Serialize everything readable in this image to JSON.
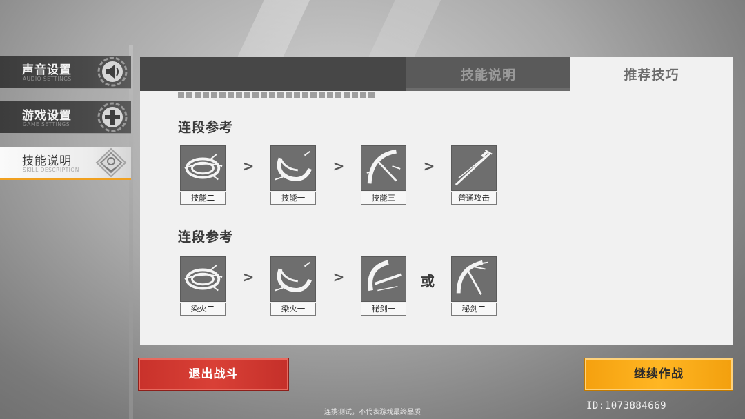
{
  "side_menu": {
    "items": [
      {
        "title": "声音设置",
        "subtitle": "AUDIO SETTINGS",
        "icon": "speaker-icon"
      },
      {
        "title": "游戏设置",
        "subtitle": "GAME SETTINGS",
        "icon": "gamepad-icon"
      },
      {
        "title": "技能说明",
        "subtitle": "SKILL DESCRIPTION",
        "icon": "skill-emblem-icon",
        "active": true
      }
    ]
  },
  "tabs": {
    "skill_description": "技能说明",
    "recommended_tips": "推荐技巧",
    "active": "recommended_tips"
  },
  "combos": [
    {
      "title": "连段参考",
      "skills": [
        {
          "label": "技能二",
          "icon": "swirl-slash-icon"
        },
        {
          "label": "技能一",
          "icon": "crescent-slash-icon"
        },
        {
          "label": "技能三",
          "icon": "crossed-blades-icon"
        },
        {
          "label": "普通攻击",
          "icon": "katana-icon"
        }
      ],
      "separators": [
        ">",
        ">",
        ">"
      ]
    },
    {
      "title": "连段参考",
      "skills": [
        {
          "label": "染火二",
          "icon": "swirl-slash-icon"
        },
        {
          "label": "染火一",
          "icon": "crescent-slash-icon"
        },
        {
          "label": "秘剑一",
          "icon": "arc-cut-icon"
        },
        {
          "label": "秘剑二",
          "icon": "crossed-blades-icon"
        }
      ],
      "separators": [
        ">",
        ">",
        "或"
      ]
    }
  ],
  "buttons": {
    "exit": "退出战斗",
    "continue": "继续作战"
  },
  "player_id": "ID:1073884669",
  "disclaimer": "连携测试，不代表游戏最终品质",
  "colors": {
    "exit_button": "#d43b32",
    "continue_button": "#ffb021",
    "active_accent": "#f0a020"
  }
}
